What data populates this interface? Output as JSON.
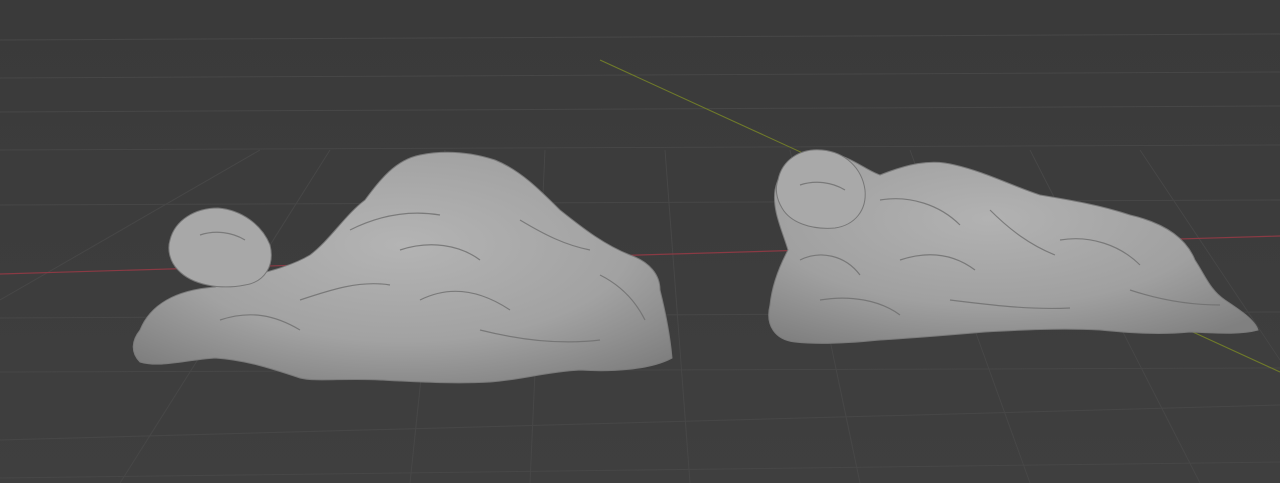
{
  "viewport": {
    "background": "#3d3d3d",
    "grid_color": "#474747",
    "x_axis_color": "#8a3a44",
    "y_axis_color": "#6f7a2a",
    "shading": "solid",
    "view": "perspective"
  },
  "objects": [
    {
      "kind": "sculpted-mesh",
      "description_name": "reclining-figure-with-drapery",
      "color": "#a9a9a9",
      "selected": false
    },
    {
      "kind": "sculpted-mesh",
      "description_name": "reclining-figure-sleeping",
      "color": "#a9a9a9",
      "selected": false
    }
  ]
}
